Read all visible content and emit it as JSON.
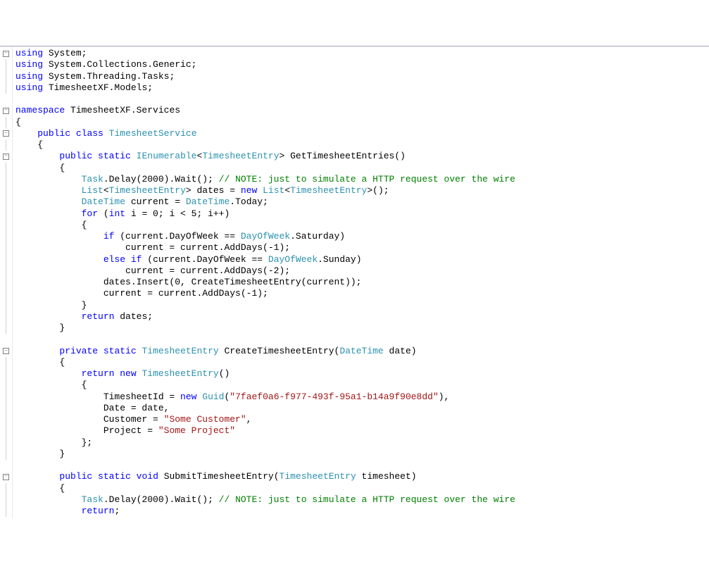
{
  "code": {
    "lines": [
      [
        {
          "t": "using",
          "c": "kw"
        },
        {
          "t": " System;"
        }
      ],
      [
        {
          "t": "using",
          "c": "kw"
        },
        {
          "t": " System.Collections.Generic;"
        }
      ],
      [
        {
          "t": "using",
          "c": "kw"
        },
        {
          "t": " System.Threading.Tasks;"
        }
      ],
      [
        {
          "t": "using",
          "c": "kw"
        },
        {
          "t": " TimesheetXF.Models;"
        }
      ],
      [],
      [
        {
          "t": "namespace",
          "c": "kw"
        },
        {
          "t": " TimesheetXF.Services"
        }
      ],
      [
        {
          "t": "{"
        }
      ],
      [
        {
          "t": "    "
        },
        {
          "t": "public",
          "c": "kw"
        },
        {
          "t": " "
        },
        {
          "t": "class",
          "c": "kw"
        },
        {
          "t": " "
        },
        {
          "t": "TimesheetService",
          "c": "type"
        }
      ],
      [
        {
          "t": "    {"
        }
      ],
      [
        {
          "t": "        "
        },
        {
          "t": "public",
          "c": "kw"
        },
        {
          "t": " "
        },
        {
          "t": "static",
          "c": "kw"
        },
        {
          "t": " "
        },
        {
          "t": "IEnumerable",
          "c": "type"
        },
        {
          "t": "<"
        },
        {
          "t": "TimesheetEntry",
          "c": "type"
        },
        {
          "t": "> GetTimesheetEntries()"
        }
      ],
      [
        {
          "t": "        {"
        }
      ],
      [
        {
          "t": "            "
        },
        {
          "t": "Task",
          "c": "type"
        },
        {
          "t": ".Delay(2000).Wait(); "
        },
        {
          "t": "// NOTE: just to simulate a HTTP request over the wire",
          "c": "comment"
        }
      ],
      [
        {
          "t": "            "
        },
        {
          "t": "List",
          "c": "type"
        },
        {
          "t": "<"
        },
        {
          "t": "TimesheetEntry",
          "c": "type"
        },
        {
          "t": "> dates = "
        },
        {
          "t": "new",
          "c": "kw"
        },
        {
          "t": " "
        },
        {
          "t": "List",
          "c": "type"
        },
        {
          "t": "<"
        },
        {
          "t": "TimesheetEntry",
          "c": "type"
        },
        {
          "t": ">();"
        }
      ],
      [
        {
          "t": "            "
        },
        {
          "t": "DateTime",
          "c": "type"
        },
        {
          "t": " current = "
        },
        {
          "t": "DateTime",
          "c": "type"
        },
        {
          "t": ".Today;"
        }
      ],
      [
        {
          "t": "            "
        },
        {
          "t": "for",
          "c": "kw"
        },
        {
          "t": " ("
        },
        {
          "t": "int",
          "c": "kw"
        },
        {
          "t": " i = 0; i < 5; i++)"
        }
      ],
      [
        {
          "t": "            {"
        }
      ],
      [
        {
          "t": "                "
        },
        {
          "t": "if",
          "c": "kw"
        },
        {
          "t": " (current.DayOfWeek == "
        },
        {
          "t": "DayOfWeek",
          "c": "type"
        },
        {
          "t": ".Saturday)"
        }
      ],
      [
        {
          "t": "                    current = current.AddDays(-1);"
        }
      ],
      [
        {
          "t": "                "
        },
        {
          "t": "else",
          "c": "kw"
        },
        {
          "t": " "
        },
        {
          "t": "if",
          "c": "kw"
        },
        {
          "t": " (current.DayOfWeek == "
        },
        {
          "t": "DayOfWeek",
          "c": "type"
        },
        {
          "t": ".Sunday)"
        }
      ],
      [
        {
          "t": "                    current = current.AddDays(-2);"
        }
      ],
      [
        {
          "t": "                dates.Insert(0, CreateTimesheetEntry(current));"
        }
      ],
      [
        {
          "t": "                current = current.AddDays(-1);"
        }
      ],
      [
        {
          "t": "            }"
        }
      ],
      [
        {
          "t": "            "
        },
        {
          "t": "return",
          "c": "kw"
        },
        {
          "t": " dates;"
        }
      ],
      [
        {
          "t": "        }"
        }
      ],
      [],
      [
        {
          "t": "        "
        },
        {
          "t": "private",
          "c": "kw"
        },
        {
          "t": " "
        },
        {
          "t": "static",
          "c": "kw"
        },
        {
          "t": " "
        },
        {
          "t": "TimesheetEntry",
          "c": "type"
        },
        {
          "t": " CreateTimesheetEntry("
        },
        {
          "t": "DateTime",
          "c": "type"
        },
        {
          "t": " date)"
        }
      ],
      [
        {
          "t": "        {"
        }
      ],
      [
        {
          "t": "            "
        },
        {
          "t": "return",
          "c": "kw"
        },
        {
          "t": " "
        },
        {
          "t": "new",
          "c": "kw"
        },
        {
          "t": " "
        },
        {
          "t": "TimesheetEntry",
          "c": "type"
        },
        {
          "t": "()"
        }
      ],
      [
        {
          "t": "            {"
        }
      ],
      [
        {
          "t": "                TimesheetId = "
        },
        {
          "t": "new",
          "c": "kw"
        },
        {
          "t": " "
        },
        {
          "t": "Guid",
          "c": "type"
        },
        {
          "t": "("
        },
        {
          "t": "\"7faef0a6-f977-493f-95a1-b14a9f90e8dd\"",
          "c": "str"
        },
        {
          "t": "),"
        }
      ],
      [
        {
          "t": "                Date = date,"
        }
      ],
      [
        {
          "t": "                Customer = "
        },
        {
          "t": "\"Some Customer\"",
          "c": "str"
        },
        {
          "t": ","
        }
      ],
      [
        {
          "t": "                Project = "
        },
        {
          "t": "\"Some Project\"",
          "c": "str"
        }
      ],
      [
        {
          "t": "            };"
        }
      ],
      [
        {
          "t": "        }"
        }
      ],
      [],
      [
        {
          "t": "        "
        },
        {
          "t": "public",
          "c": "kw"
        },
        {
          "t": " "
        },
        {
          "t": "static",
          "c": "kw"
        },
        {
          "t": " "
        },
        {
          "t": "void",
          "c": "kw"
        },
        {
          "t": " SubmitTimesheetEntry("
        },
        {
          "t": "TimesheetEntry",
          "c": "type"
        },
        {
          "t": " timesheet)"
        }
      ],
      [
        {
          "t": "        {"
        }
      ],
      [
        {
          "t": "            "
        },
        {
          "t": "Task",
          "c": "type"
        },
        {
          "t": ".Delay(2000).Wait(); "
        },
        {
          "t": "// NOTE: just to simulate a HTTP request over the wire",
          "c": "comment"
        }
      ],
      [
        {
          "t": "            "
        },
        {
          "t": "return",
          "c": "kw"
        },
        {
          "t": ";"
        }
      ]
    ],
    "gutter": [
      {
        "type": "box",
        "sym": "−"
      },
      {
        "type": "line"
      },
      {
        "type": "line"
      },
      {
        "type": "line"
      },
      {
        "type": "none"
      },
      {
        "type": "box",
        "sym": "−"
      },
      {
        "type": "line"
      },
      {
        "type": "box",
        "sym": "−"
      },
      {
        "type": "line"
      },
      {
        "type": "box",
        "sym": "−"
      },
      {
        "type": "line"
      },
      {
        "type": "line"
      },
      {
        "type": "line"
      },
      {
        "type": "line"
      },
      {
        "type": "line"
      },
      {
        "type": "line"
      },
      {
        "type": "line"
      },
      {
        "type": "line"
      },
      {
        "type": "line"
      },
      {
        "type": "line"
      },
      {
        "type": "line"
      },
      {
        "type": "line"
      },
      {
        "type": "line"
      },
      {
        "type": "line"
      },
      {
        "type": "line"
      },
      {
        "type": "none"
      },
      {
        "type": "box",
        "sym": "−"
      },
      {
        "type": "line"
      },
      {
        "type": "line"
      },
      {
        "type": "line"
      },
      {
        "type": "line"
      },
      {
        "type": "line"
      },
      {
        "type": "line"
      },
      {
        "type": "line"
      },
      {
        "type": "line"
      },
      {
        "type": "line"
      },
      {
        "type": "none"
      },
      {
        "type": "box",
        "sym": "−"
      },
      {
        "type": "line"
      },
      {
        "type": "line"
      },
      {
        "type": "line"
      }
    ]
  }
}
